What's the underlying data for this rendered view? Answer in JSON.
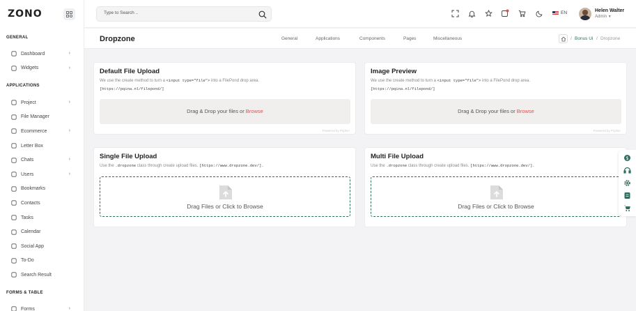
{
  "logo": "ZONO",
  "sidebar": {
    "sections": [
      {
        "title": "GENERAL",
        "items": [
          {
            "label": "Dashboard",
            "icon": "home-icon",
            "chevron": true
          },
          {
            "label": "Widgets",
            "icon": "widget-icon",
            "chevron": true
          }
        ]
      },
      {
        "title": "APPLICATIONS",
        "items": [
          {
            "label": "Project",
            "icon": "project-icon",
            "chevron": true
          },
          {
            "label": "File Manager",
            "icon": "file-icon",
            "chevron": false
          },
          {
            "label": "Ecommerce",
            "icon": "bag-icon",
            "chevron": true
          },
          {
            "label": "Letter Box",
            "icon": "mail-icon",
            "chevron": false
          },
          {
            "label": "Chats",
            "icon": "chat-icon",
            "chevron": true
          },
          {
            "label": "Users",
            "icon": "user-icon",
            "chevron": true
          },
          {
            "label": "Bookmarks",
            "icon": "bookmark-icon",
            "chevron": false
          },
          {
            "label": "Contacts",
            "icon": "phone-icon",
            "chevron": false
          },
          {
            "label": "Tasks",
            "icon": "task-icon",
            "chevron": false
          },
          {
            "label": "Calendar",
            "icon": "calendar-icon",
            "chevron": false
          },
          {
            "label": "Social App",
            "icon": "social-icon",
            "chevron": false
          },
          {
            "label": "To-Do",
            "icon": "todo-icon",
            "chevron": false
          },
          {
            "label": "Search Result",
            "icon": "search-icon",
            "chevron": false
          }
        ]
      },
      {
        "title": "FORMS & TABLE",
        "items": [
          {
            "label": "Forms",
            "icon": "form-icon",
            "chevron": true
          }
        ]
      }
    ]
  },
  "header": {
    "search_placeholder": "Type to Search ..",
    "language": "EN",
    "user_name": "Helen Walter",
    "user_role": "Admin"
  },
  "page": {
    "title": "Dropzone",
    "tabs": [
      "General",
      "Applications",
      "Components",
      "Pages",
      "Miscellaneous"
    ],
    "breadcrumb": {
      "parent": "Bonus Ui",
      "sep": "/",
      "current": "Dropzone"
    }
  },
  "cards": {
    "default_upload": {
      "title": "Default File Upload",
      "desc_before": "We use the create method to turn a ",
      "desc_code": "<input type=\"file\">",
      "desc_after": " into a FilePond drop area.",
      "link": "[https://pqina.nl/filepond/]",
      "drop_text": "Drag & Drop your files or ",
      "browse": "Browse",
      "credit": "Powered by PQINA"
    },
    "image_preview": {
      "title": "Image Preview",
      "desc_before": "We use the create method to turn a ",
      "desc_code": "<input type=\"file\">",
      "desc_after": " into a FilePond drop area.",
      "link": "[https://pqina.nl/filepond/]",
      "drop_text": "Drag & Drop your files or ",
      "browse": "Browse",
      "credit": "Powered by PQINA"
    },
    "single_upload": {
      "title": "Single File Upload",
      "desc_before": "Use the ",
      "desc_code": ".dropzone",
      "desc_after": " class through create upload files. ",
      "desc_link": "[https://www.dropzone.dev/].",
      "dz_text": "Drag Files or Click to Browse"
    },
    "multi_upload": {
      "title": "Multi File Upload",
      "desc_before": "Use the ",
      "desc_code": ".dropzone",
      "desc_after": " class through create upload files. ",
      "desc_link": "[https://www.dropzone.dev/].",
      "dz_text": "Drag Files or Click to Browse"
    }
  },
  "colors": {
    "accent": "#2f6d5e",
    "browse": "#e34d4d",
    "notification_badge": "#e34d4d"
  }
}
